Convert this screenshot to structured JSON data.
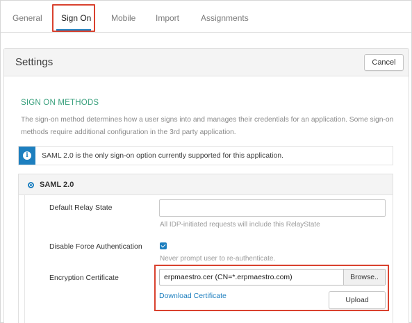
{
  "tabs": [
    {
      "label": "General"
    },
    {
      "label": "Sign On"
    },
    {
      "label": "Mobile"
    },
    {
      "label": "Import"
    },
    {
      "label": "Assignments"
    }
  ],
  "active_tab": "Sign On",
  "settings": {
    "title": "Settings",
    "cancel_label": "Cancel",
    "section_title": "SIGN ON METHODS",
    "description": "The sign-on method determines how a user signs into and manages their credentials for an application. Some sign-on methods require additional configuration in the 3rd party application.",
    "info_icon": "info-icon",
    "info_text": "SAML 2.0 is the only sign-on option currently supported for this application.",
    "method": {
      "label": "SAML 2.0",
      "selected": true
    },
    "fields": {
      "relay_state": {
        "label": "Default Relay State",
        "value": "",
        "hint": "All IDP-initiated requests will include this RelayState"
      },
      "force_auth": {
        "label": "Disable Force Authentication",
        "checked": true,
        "hint": "Never prompt user to re-authenticate."
      },
      "encryption_cert": {
        "label": "Encryption Certificate",
        "value": "erpmaestro.cer (CN=*.erpmaestro.com)",
        "browse_label": "Browse..",
        "download_link": "Download Certificate",
        "upload_label": "Upload"
      }
    }
  },
  "colors": {
    "accent_blue": "#1d7fbf",
    "section_green": "#3aa07d",
    "highlight_red": "#d9412e"
  }
}
